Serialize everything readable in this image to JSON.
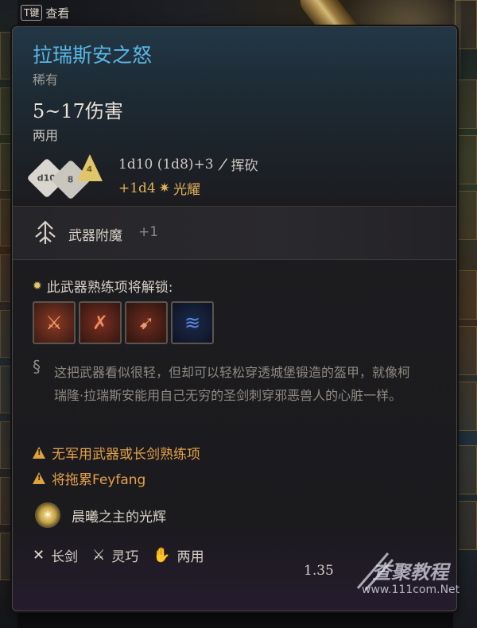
{
  "key_hint": {
    "key": "T键",
    "label": "查看"
  },
  "item": {
    "name": "拉瑞斯安之怒",
    "rarity": "稀有",
    "damage": "5~17伤害",
    "handedness": "两用",
    "dice_labels": [
      "d10",
      "8",
      "4"
    ],
    "damage_line1": "1d10 (1d8)+3",
    "damage_type1": "挥砍",
    "damage_line2": "+1d4",
    "damage_type2": "光耀",
    "enchant_label": "武器附魔",
    "enchant_value": "+1",
    "unlock_label": "此武器熟练项将解锁:",
    "description": "这把武器看似很轻，但却可以轻松穿透城堡锻造的盔甲，就像柯瑞隆·拉瑞斯安能用自己无穷的圣剑刺穿邪恶兽人的心脏一样。",
    "warnings": [
      "无军用武器或长剑熟练项",
      "将拖累Feyfang"
    ],
    "blessing": "晨曦之主的光辉",
    "properties": [
      {
        "label": "长剑",
        "icon": "longsword-icon"
      },
      {
        "label": "灵巧",
        "icon": "finesse-icon"
      },
      {
        "label": "两用",
        "icon": "versatile-hand-icon"
      }
    ],
    "footer_value": "1.35"
  },
  "skills": [
    {
      "icon": "skill-slash-icon",
      "color": "#f4a76a"
    },
    {
      "icon": "skill-sword-icon",
      "color": "#f08a60"
    },
    {
      "icon": "skill-pierce-icon",
      "color": "#e89a6a"
    },
    {
      "icon": "skill-wave-icon",
      "color": "#5a8ae8"
    }
  ],
  "watermark": {
    "text": "查聚教程",
    "url": "www.111com.Net"
  },
  "colors": {
    "title": "#5ab6e6",
    "radiant": "#e0b15a",
    "warning": "#e4a24a"
  }
}
